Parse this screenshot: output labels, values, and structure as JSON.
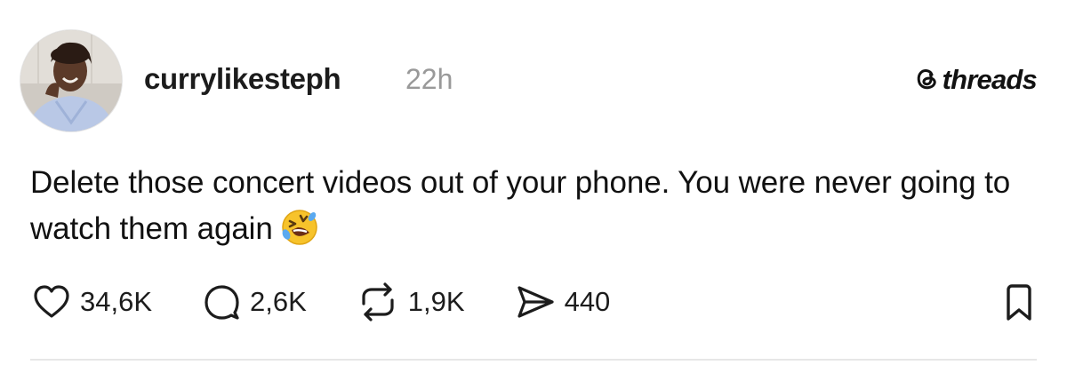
{
  "post": {
    "username": "currylikesteph",
    "time": "22h",
    "text": "Delete those concert videos out of your phone. You were never going to watch them again",
    "emoji": "rolling-on-the-floor-laughing-emoji"
  },
  "brand": {
    "label": "threads",
    "icon": "threads-logo-icon"
  },
  "actions": {
    "likes": "34,6K",
    "replies": "2,6K",
    "reposts": "1,9K",
    "shares": "440"
  },
  "icons": {
    "like": "heart-icon",
    "reply": "comment-icon",
    "repost": "repost-icon",
    "share": "send-icon",
    "save": "bookmark-icon"
  }
}
